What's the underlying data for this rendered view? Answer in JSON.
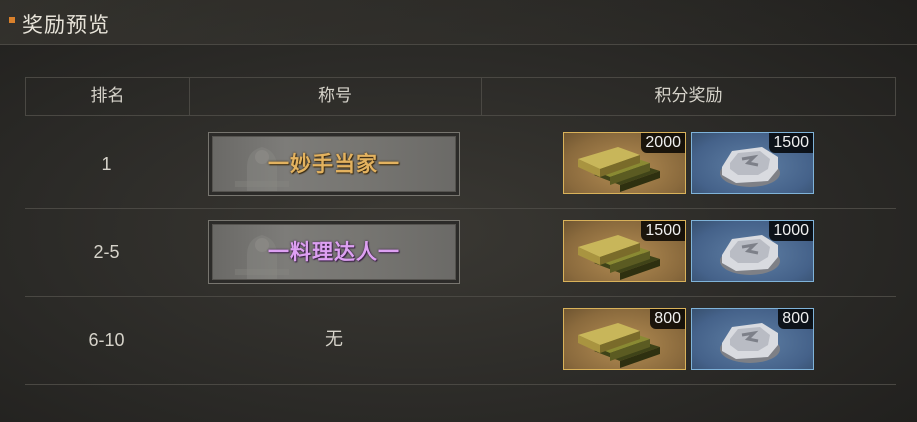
{
  "header": {
    "title": "奖励预览",
    "accent_color": "#d9802b"
  },
  "table": {
    "columns": [
      "排名",
      "称号",
      "积分奖励"
    ],
    "rows": [
      {
        "rank": "1",
        "title": {
          "type": "plaque",
          "text": "一妙手当家一",
          "color": "gold"
        },
        "rewards": [
          {
            "icon": "gold-bars-icon",
            "count": "2000"
          },
          {
            "icon": "silver-coin-icon",
            "count": "1500"
          }
        ]
      },
      {
        "rank": "2-5",
        "title": {
          "type": "plaque",
          "text": "一料理达人一",
          "color": "purple"
        },
        "rewards": [
          {
            "icon": "gold-bars-icon",
            "count": "1500"
          },
          {
            "icon": "silver-coin-icon",
            "count": "1000"
          }
        ]
      },
      {
        "rank": "6-10",
        "title": {
          "type": "none",
          "text": "无"
        },
        "rewards": [
          {
            "icon": "gold-bars-icon",
            "count": "800"
          },
          {
            "icon": "silver-coin-icon",
            "count": "800"
          }
        ]
      }
    ]
  }
}
